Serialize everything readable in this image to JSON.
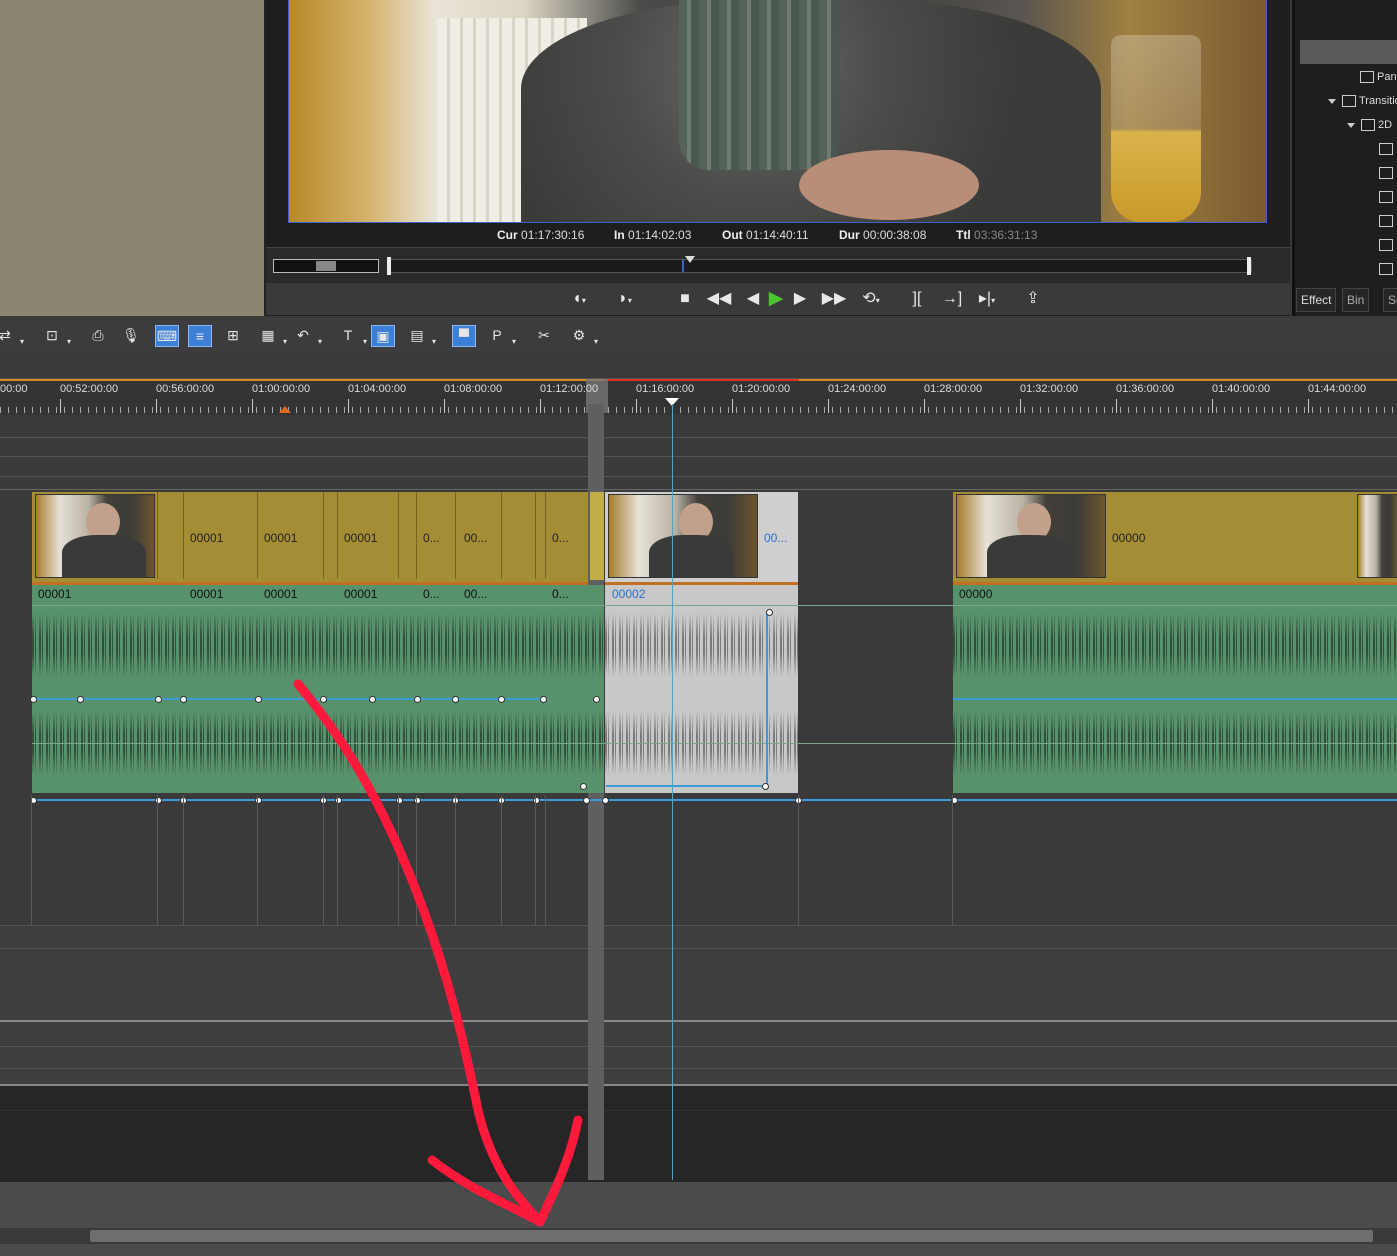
{
  "player": {
    "timecodes": [
      {
        "label": "Cur",
        "value": "01:17:30:16"
      },
      {
        "label": "In",
        "value": "01:14:02:03"
      },
      {
        "label": "Out",
        "value": "01:14:40:11"
      },
      {
        "label": "Dur",
        "value": "00:00:38:08"
      },
      {
        "label": "Ttl",
        "value": "03:36:31:13"
      }
    ],
    "transport_icons": [
      "mark-in-icon",
      "mark-out-icon",
      "stop-icon",
      "rewind-icon",
      "step-back-icon",
      "play-icon",
      "step-forward-icon",
      "fast-forward-icon",
      "loop-icon",
      "jump-in-icon",
      "jump-out-icon",
      "play-to-out-icon",
      "export-icon"
    ]
  },
  "effects_panel": {
    "items": [
      {
        "label": "Pan",
        "icon": "effect-icon"
      },
      {
        "label": "Transitio",
        "icon": "folder-icon"
      },
      {
        "label": "2D",
        "icon": "folder-icon"
      }
    ],
    "tabs": [
      "Effect",
      "Bin",
      "Sc"
    ]
  },
  "ruler": {
    "labels": [
      "00:00",
      "00:52:00:00",
      "00:56:00:00",
      "01:00:00:00",
      "01:04:00:00",
      "01:08:00:00",
      "01:12:00:00",
      "01:16:00:00",
      "01:20:00:00",
      "01:24:00:00",
      "01:28:00:00",
      "01:32:00:00",
      "01:36:00:00",
      "01:40:00:00",
      "01:44:00:00"
    ]
  },
  "video_clips": {
    "labels": [
      "00001",
      "00001",
      "00001",
      "0...",
      "00...",
      "0...",
      "00...",
      "00000"
    ]
  },
  "audio_clips": {
    "labels": [
      "00001",
      "00001",
      "00001",
      "00001",
      "0...",
      "00...",
      "0...",
      "00002",
      "00000"
    ]
  },
  "colors": {
    "video_clip": "#a58d35",
    "audio_clip": "#58926c",
    "selected_audio": "#c8c8c8",
    "playhead": "#4aa7c9",
    "annotation_arrow": "#ff1a3c"
  }
}
